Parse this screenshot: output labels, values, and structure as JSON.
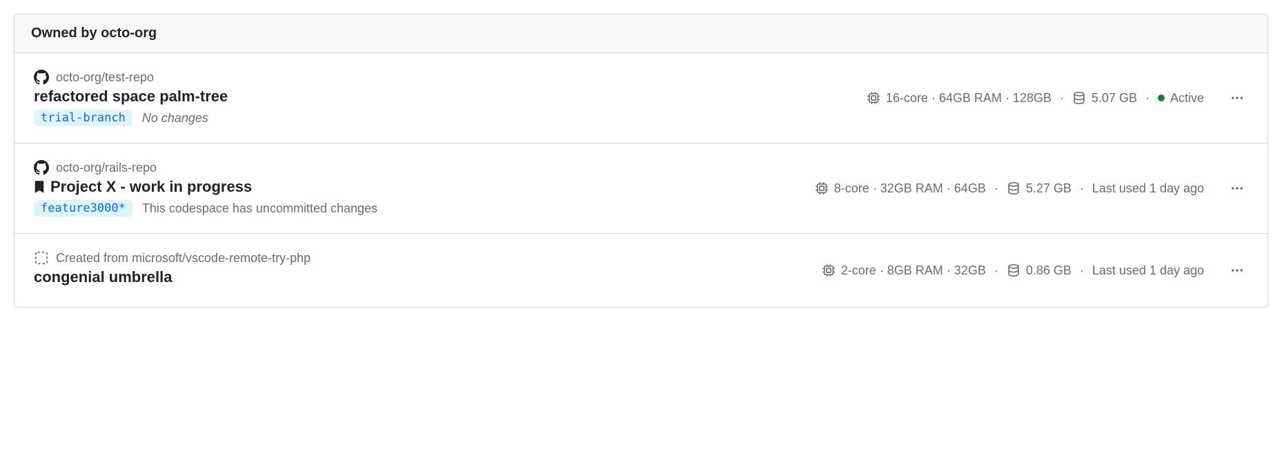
{
  "header": {
    "title": "Owned by octo-org"
  },
  "items": [
    {
      "repo": "octo-org/test-repo",
      "repo_icon": "github",
      "name": "refactored space palm-tree",
      "bookmarked": false,
      "branch": "trial-branch",
      "changes": "No changes",
      "changes_italic": true,
      "specs": "16-core · 64GB RAM · 128GB",
      "storage": "5.07 GB",
      "status_label": "Active",
      "status_dot": true
    },
    {
      "repo": "octo-org/rails-repo",
      "repo_icon": "github",
      "name": "Project X - work in progress",
      "bookmarked": true,
      "branch": "feature3000*",
      "changes": "This codespace has uncommitted changes",
      "changes_italic": false,
      "specs": "8-core · 32GB RAM · 64GB",
      "storage": "5.27 GB",
      "status_label": "Last used 1 day ago",
      "status_dot": false
    },
    {
      "repo": "Created from microsoft/vscode-remote-try-php",
      "repo_icon": "template",
      "name": "congenial umbrella",
      "bookmarked": false,
      "branch": null,
      "changes": null,
      "specs": "2-core · 8GB RAM · 32GB",
      "storage": "0.86 GB",
      "status_label": "Last used 1 day ago",
      "status_dot": false
    }
  ]
}
